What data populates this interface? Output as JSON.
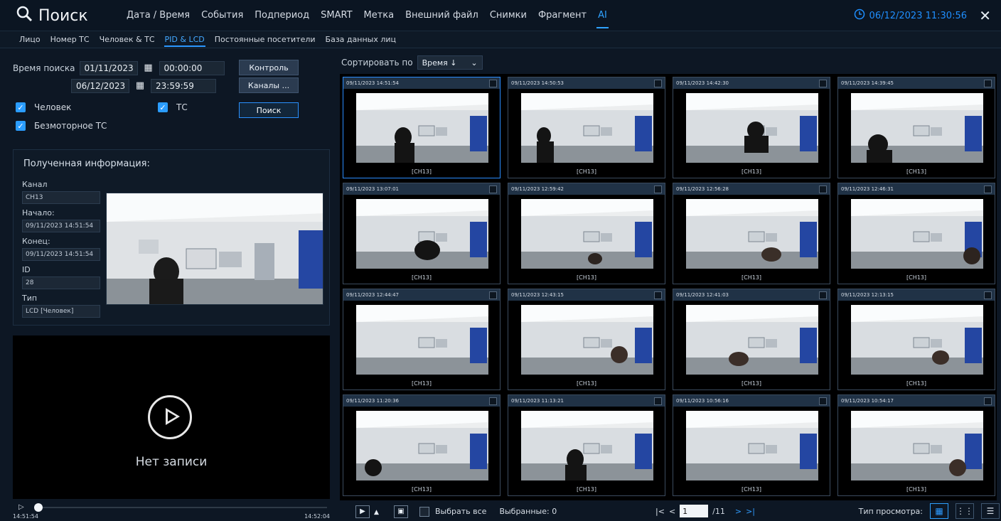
{
  "header": {
    "title": "Поиск",
    "tabs": [
      "Дата / Время",
      "События",
      "Подпериод",
      "SMART",
      "Метка",
      "Внешний файл",
      "Снимки",
      "Фрагмент",
      "AI"
    ],
    "active_tab": "AI",
    "clock": "06/12/2023 11:30:56"
  },
  "subtabs": {
    "items": [
      "Лицо",
      "Номер ТС",
      "Человек & ТС",
      "PID & LCD",
      "Постоянные посетители",
      "База данных лиц"
    ],
    "active": "PID & LCD"
  },
  "search": {
    "label": "Время поиска",
    "start_date": "01/11/2023",
    "start_time": "00:00:00",
    "end_date": "06/12/2023",
    "end_time": "23:59:59",
    "control_btn": "Контроль",
    "channels_btn": "Каналы ...",
    "search_btn": "Поиск",
    "human_chk": "Человек",
    "vehicle_chk": "ТС",
    "nonmotor_chk": "Безмоторное ТС"
  },
  "info": {
    "title": "Полученная информация:",
    "channel_label": "Канал",
    "channel_value": "CH13",
    "start_label": "Начало:",
    "start_value": "09/11/2023 14:51:54",
    "end_label": "Конец:",
    "end_value": "09/11/2023 14:51:54",
    "id_label": "ID",
    "id_value": "28",
    "type_label": "Тип",
    "type_value": "LCD [Человек]"
  },
  "player": {
    "no_record": "Нет записи",
    "time_start": "14:51:54",
    "time_end": "14:52:04"
  },
  "sort": {
    "label": "Сортировать по",
    "value": "Время ↓"
  },
  "thumbs": [
    {
      "time": "09/11/2023 14:51:54",
      "ch": "[CH13]"
    },
    {
      "time": "09/11/2023 14:50:53",
      "ch": "[CH13]"
    },
    {
      "time": "09/11/2023 14:42:30",
      "ch": "[CH13]"
    },
    {
      "time": "09/11/2023 14:39:45",
      "ch": "[CH13]"
    },
    {
      "time": "09/11/2023 13:07:01",
      "ch": "[CH13]"
    },
    {
      "time": "09/11/2023 12:59:42",
      "ch": "[CH13]"
    },
    {
      "time": "09/11/2023 12:56:28",
      "ch": "[CH13]"
    },
    {
      "time": "09/11/2023 12:46:31",
      "ch": "[CH13]"
    },
    {
      "time": "09/11/2023 12:44:47",
      "ch": "[CH13]"
    },
    {
      "time": "09/11/2023 12:43:15",
      "ch": "[CH13]"
    },
    {
      "time": "09/11/2023 12:41:03",
      "ch": "[CH13]"
    },
    {
      "time": "09/11/2023 12:13:15",
      "ch": "[CH13]"
    },
    {
      "time": "09/11/2023 11:20:36",
      "ch": "[CH13]"
    },
    {
      "time": "09/11/2023 11:13:21",
      "ch": "[CH13]"
    },
    {
      "time": "09/11/2023 10:56:16",
      "ch": "[CH13]"
    },
    {
      "time": "09/11/2023 10:54:17",
      "ch": "[CH13]"
    }
  ],
  "bottom": {
    "select_all": "Выбрать все",
    "selected": "Выбранные: 0",
    "page": "1",
    "total": "/11",
    "view_label": "Тип просмотра:"
  }
}
